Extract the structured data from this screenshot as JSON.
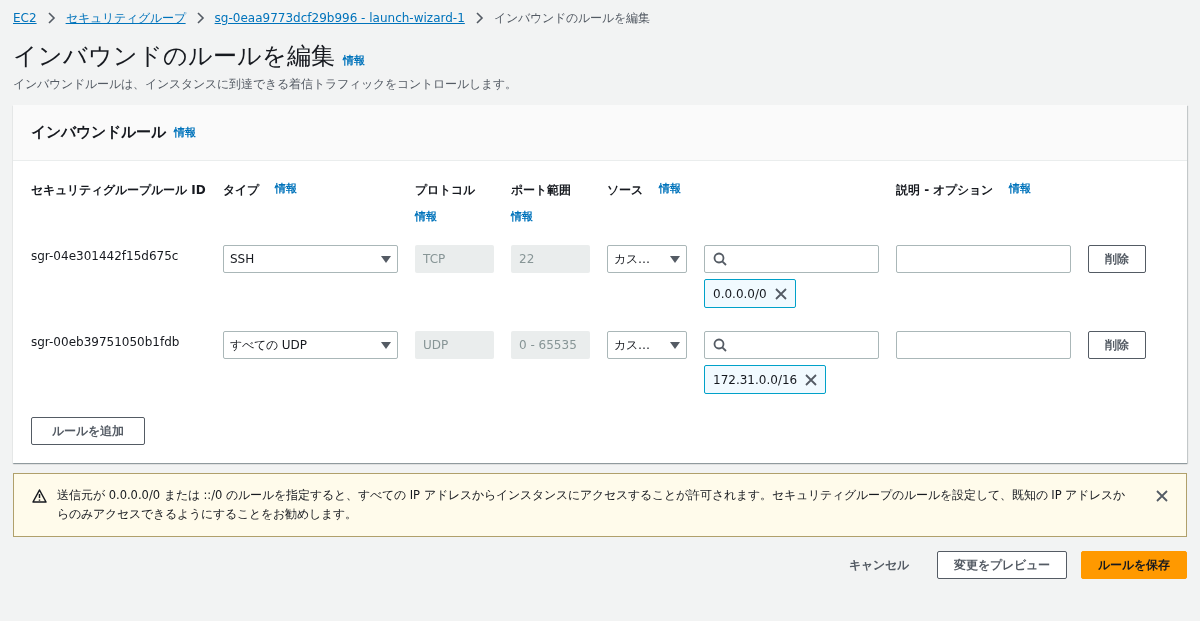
{
  "breadcrumbs": [
    {
      "label": "EC2",
      "link": true
    },
    {
      "label": "セキュリティグループ",
      "link": true
    },
    {
      "label": "sg-0eaa9773dcf29b996 - launch-wizard-1",
      "link": true
    },
    {
      "label": "インバウンドのルールを編集",
      "link": false
    }
  ],
  "page": {
    "title": "インバウンドのルールを編集",
    "info": "情報",
    "description": "インバウンドルールは、インスタンスに到達できる着信トラフィックをコントロールします。"
  },
  "panel": {
    "title": "インバウンドルール",
    "info": "情報",
    "columns": [
      {
        "label": "セキュリティグループルール ID"
      },
      {
        "label": "タイプ",
        "info": "情報"
      },
      {
        "label": "プロトコル",
        "info": "情報"
      },
      {
        "label": "ポート範囲",
        "info": "情報"
      },
      {
        "label": "ソース",
        "info": "情報"
      },
      {
        "label": "説明 - オプション",
        "info": "情報"
      }
    ],
    "rows": [
      {
        "id": "sgr-04e301442f15d675c",
        "type": "SSH",
        "protocol": "TCP",
        "port": "22",
        "source": "カス…",
        "cidr": "0.0.0.0/0",
        "delete": "削除"
      },
      {
        "id": "sgr-00eb39751050b1fdb",
        "type": "すべての UDP",
        "protocol": "UDP",
        "port": "0 - 65535",
        "source": "カス…",
        "cidr": "172.31.0.0/16",
        "delete": "削除"
      }
    ],
    "add_button": "ルールを追加"
  },
  "alert": {
    "text": "送信元が 0.0.0.0/0 または ::/0 のルールを指定すると、すべての IP アドレスからインスタンスにアクセスすることが許可されます。セキュリティグループのルールを設定して、既知の IP アドレスからのみアクセスできるようにすることをお勧めします。"
  },
  "actions": {
    "cancel": "キャンセル",
    "preview": "変更をプレビュー",
    "save": "ルールを保存"
  }
}
